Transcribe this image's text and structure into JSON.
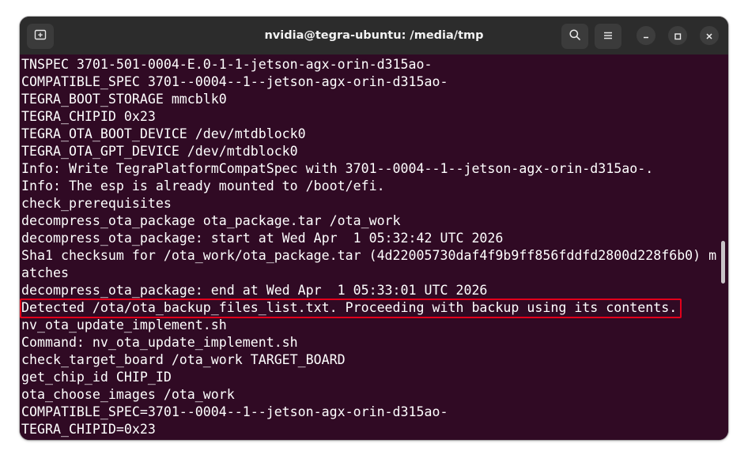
{
  "window": {
    "title": "nvidia@tegra-ubuntu: /media/tmp"
  },
  "icons": {
    "new_tab": "new-tab-icon",
    "search": "search-icon",
    "menu": "hamburger-menu-icon",
    "minimize": "minimize-icon",
    "maximize": "maximize-icon",
    "close": "close-icon"
  },
  "colors": {
    "terminal_bg": "#300a24",
    "titlebar_bg": "#2c2c2c",
    "text": "#ffffff",
    "highlight_border": "#e3001b"
  },
  "terminal": {
    "lines": [
      "TNSPEC 3701-501-0004-E.0-1-1-jetson-agx-orin-d315ao-",
      "COMPATIBLE_SPEC 3701--0004--1--jetson-agx-orin-d315ao-",
      "TEGRA_BOOT_STORAGE mmcblk0",
      "TEGRA_CHIPID 0x23",
      "TEGRA_OTA_BOOT_DEVICE /dev/mtdblock0",
      "TEGRA_OTA_GPT_DEVICE /dev/mtdblock0",
      "Info: Write TegraPlatformCompatSpec with 3701--0004--1--jetson-agx-orin-d315ao-.",
      "Info: The esp is already mounted to /boot/efi.",
      "check_prerequisites",
      "decompress_ota_package ota_package.tar /ota_work",
      "decompress_ota_package: start at Wed Apr  1 05:32:42 UTC 2026",
      "Sha1 checksum for /ota_work/ota_package.tar (4d22005730daf4f9b9ff856fddfd2800d228f6b0) m",
      "atches",
      "decompress_ota_package: end at Wed Apr  1 05:33:01 UTC 2026",
      "Detected /ota/ota_backup_files_list.txt. Proceeding with backup using its contents.",
      "nv_ota_update_implement.sh",
      "Command: nv_ota_update_implement.sh",
      "check_target_board /ota_work TARGET_BOARD",
      "get_chip_id CHIP_ID",
      "ota_choose_images /ota_work",
      "COMPATIBLE_SPEC=3701--0004--1--jetson-agx-orin-d315ao-",
      "TEGRA_CHIPID=0x23"
    ]
  }
}
